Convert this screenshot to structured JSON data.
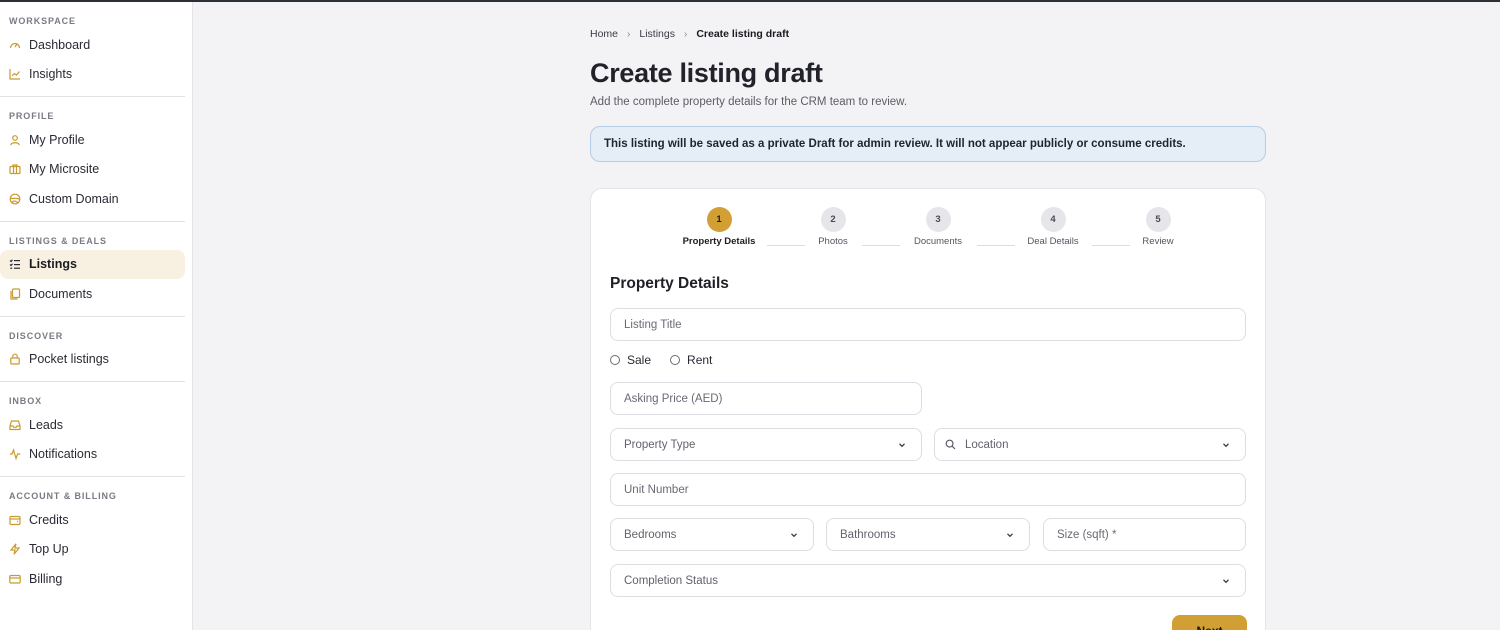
{
  "sidebar": {
    "sections": [
      {
        "title": "WORKSPACE",
        "items": [
          {
            "label": "Dashboard",
            "icon": "gauge-icon"
          },
          {
            "label": "Insights",
            "icon": "chart-line-icon"
          }
        ]
      },
      {
        "title": "PROFILE",
        "items": [
          {
            "label": "My Profile",
            "icon": "user-icon"
          },
          {
            "label": "My Microsite",
            "icon": "briefcase-icon"
          },
          {
            "label": "Custom Domain",
            "icon": "globe-icon"
          }
        ]
      },
      {
        "title": "LISTINGS & DEALS",
        "items": [
          {
            "label": "Listings",
            "icon": "list-check-icon",
            "active": true
          },
          {
            "label": "Documents",
            "icon": "files-icon"
          }
        ]
      },
      {
        "title": "DISCOVER",
        "items": [
          {
            "label": "Pocket listings",
            "icon": "lock-icon"
          }
        ]
      },
      {
        "title": "INBOX",
        "items": [
          {
            "label": "Leads",
            "icon": "inbox-icon"
          },
          {
            "label": "Notifications",
            "icon": "activity-icon"
          }
        ]
      },
      {
        "title": "ACCOUNT & BILLING",
        "items": [
          {
            "label": "Credits",
            "icon": "wallet-icon"
          },
          {
            "label": "Top Up",
            "icon": "bolt-icon"
          },
          {
            "label": "Billing",
            "icon": "card-icon"
          }
        ]
      }
    ]
  },
  "breadcrumb": {
    "home": "Home",
    "listings": "Listings",
    "current": "Create listing draft"
  },
  "page": {
    "title": "Create listing draft",
    "subtitle": "Add the complete property details for the CRM team to review."
  },
  "notice": "This listing will be saved as a private Draft for admin review. It will not appear publicly or consume credits.",
  "stepper": {
    "steps": [
      {
        "number": "1",
        "label": "Property Details",
        "active": true
      },
      {
        "number": "2",
        "label": "Photos"
      },
      {
        "number": "3",
        "label": "Documents"
      },
      {
        "number": "4",
        "label": "Deal Details"
      },
      {
        "number": "5",
        "label": "Review"
      }
    ]
  },
  "form": {
    "heading": "Property Details",
    "listing_title_placeholder": "Listing Title",
    "radio_sale": "Sale",
    "radio_rent": "Rent",
    "asking_price_placeholder": "Asking Price (AED)",
    "property_type": "Property Type",
    "location": "Location",
    "unit_number_placeholder": "Unit Number",
    "bedrooms": "Bedrooms",
    "bathrooms": "Bathrooms",
    "size_placeholder": "Size (sqft) *",
    "completion_status": "Completion Status",
    "next_label": "Next"
  },
  "colors": {
    "accent": "#d19f34",
    "active_nav_bg": "#f8f1e2",
    "notice_bg": "#e5eef7"
  }
}
